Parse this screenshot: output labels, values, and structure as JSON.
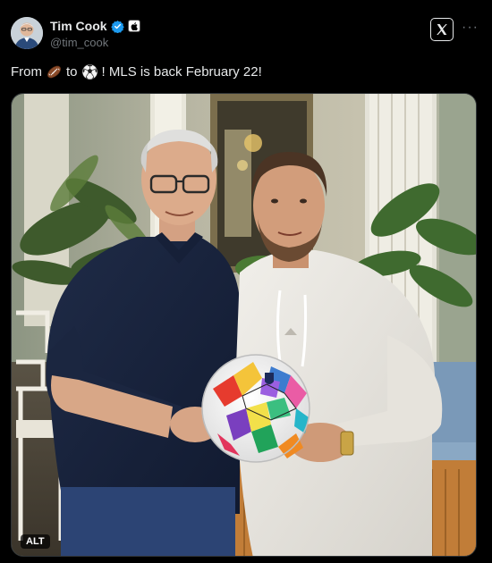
{
  "post": {
    "author": {
      "display_name": "Tim Cook",
      "handle": "@tim_cook",
      "verified_icon": "verified-badge-icon",
      "affiliate_icon": "apple-affiliate-icon"
    },
    "header_actions": {
      "logo_icon": "x-logo-icon",
      "more_label": "···"
    },
    "text": {
      "part1": "From",
      "part2": "to",
      "part3": "! MLS is back February 22!",
      "emoji1": "american-football-emoji",
      "emoji2": "soccer-ball-emoji"
    },
    "media": {
      "alt_badge": "ALT"
    }
  },
  "colors": {
    "background": "#000000",
    "primary_text": "#e7e9ea",
    "secondary_text": "#71767b",
    "verified_blue": "#1d9bf0"
  }
}
